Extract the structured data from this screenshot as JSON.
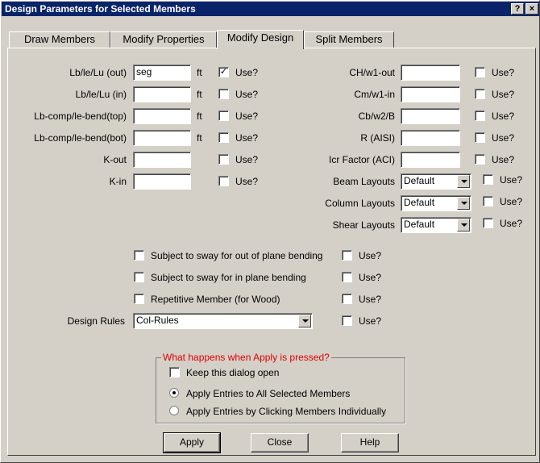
{
  "window": {
    "title": "Design Parameters for Selected Members",
    "help_btn": "?",
    "close_btn": "×"
  },
  "tabs": [
    {
      "label": "Draw Members"
    },
    {
      "label": "Modify Properties"
    },
    {
      "label": "Modify Design",
      "active": true
    },
    {
      "label": "Split Members"
    }
  ],
  "left": {
    "rows": [
      {
        "label": "Lb/le/Lu (out)",
        "value": "seg",
        "unit": "ft",
        "use": "Use?",
        "checked": true
      },
      {
        "label": "Lb/le/Lu (in)",
        "value": "",
        "unit": "ft",
        "use": "Use?",
        "checked": false
      },
      {
        "label": "Lb-comp/le-bend(top)",
        "value": "",
        "unit": "ft",
        "use": "Use?",
        "checked": false
      },
      {
        "label": "Lb-comp/le-bend(bot)",
        "value": "",
        "unit": "ft",
        "use": "Use?",
        "checked": false
      },
      {
        "label": "K-out",
        "value": "",
        "unit": "",
        "use": "Use?",
        "checked": false
      },
      {
        "label": "K-in",
        "value": "",
        "unit": "",
        "use": "Use?",
        "checked": false
      }
    ]
  },
  "right": {
    "rows": [
      {
        "label": "CH/w1-out",
        "value": "",
        "use": "Use?"
      },
      {
        "label": "Cm/w1-in",
        "value": "",
        "use": "Use?"
      },
      {
        "label": "Cb/w2/B",
        "value": "",
        "use": "Use?"
      },
      {
        "label": "R (AISI)",
        "value": "",
        "use": "Use?"
      },
      {
        "label": "Icr Factor (ACI)",
        "value": "",
        "use": "Use?"
      }
    ],
    "layouts": [
      {
        "label": "Beam Layouts",
        "value": "Default",
        "use": "Use?"
      },
      {
        "label": "Column Layouts",
        "value": "Default",
        "use": "Use?"
      },
      {
        "label": "Shear Layouts",
        "value": "Default",
        "use": "Use?"
      }
    ]
  },
  "options": [
    {
      "label": "Subject to sway for out of plane bending",
      "use": "Use?"
    },
    {
      "label": "Subject to sway for in plane bending",
      "use": "Use?"
    },
    {
      "label": "Repetitive Member (for Wood)",
      "use": "Use?"
    }
  ],
  "design_rules": {
    "label": "Design Rules",
    "value": "Col-Rules",
    "use": "Use?"
  },
  "apply_group": {
    "legend": "What happens when Apply is pressed?",
    "keep_open": "Keep this dialog open",
    "radio_all": "Apply Entries to All Selected Members",
    "radio_click": "Apply Entries by Clicking Members Individually"
  },
  "buttons": {
    "apply": "Apply",
    "close": "Close",
    "help": "Help"
  },
  "colors": {
    "title_bar": "#0a246a",
    "dialog_bg": "#d4d0c8",
    "legend_text": "#e00000"
  }
}
